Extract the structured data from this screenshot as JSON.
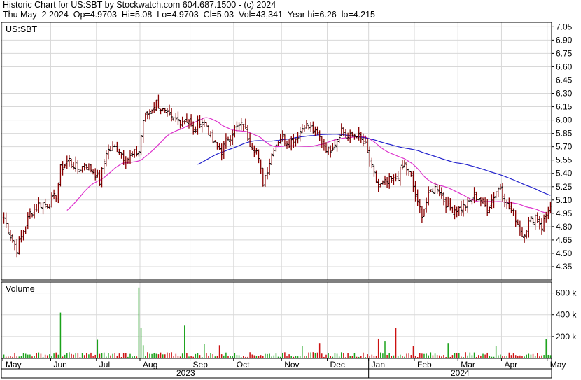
{
  "header": {
    "title": "Historic Chart for US:SBT by Stockwatch.com 604.687.1500 - (c) 2024",
    "quote": "Thu May  2 2024  Op=4.9703  Hi=5.08  Lo=4.9703  Cl=5.03  Vol=43,341  Year hi=6.26  lo=4.215"
  },
  "chart_data": {
    "type": "ohlc-bar",
    "symbol_label": "US:SBT",
    "volume_label": "Volume",
    "price_axis": {
      "ylim": [
        4.2,
        7.1
      ],
      "ticks": [
        "7.05",
        "6.90",
        "6.75",
        "6.60",
        "6.45",
        "6.30",
        "6.15",
        "6.00",
        "5.85",
        "5.70",
        "5.55",
        "5.40",
        "5.25",
        "5.10",
        "4.95",
        "4.80",
        "4.65",
        "4.50",
        "4.35"
      ],
      "grid": true
    },
    "volume_axis": {
      "ylim": [
        0,
        700000
      ],
      "ticks": [
        {
          "label": "600 k",
          "value": 600000
        },
        {
          "label": "400 k",
          "value": 400000
        },
        {
          "label": "200 k",
          "value": 200000
        }
      ]
    },
    "months": [
      "May",
      "Jun",
      "Jul",
      "Aug",
      "Sep",
      "Oct",
      "Nov",
      "Dec",
      "Jan",
      "Feb",
      "Mar",
      "Apr",
      "May"
    ],
    "years": [
      "2023",
      "2024"
    ],
    "year_of_month": [
      0,
      0,
      0,
      0,
      0,
      0,
      0,
      0,
      1,
      1,
      1,
      1,
      1
    ],
    "days_per_month": [
      22,
      21,
      20,
      23,
      20,
      22,
      21,
      19,
      21,
      20,
      20,
      21,
      2
    ],
    "price_anchors": [
      [
        0,
        4.9
      ],
      [
        3,
        4.7
      ],
      [
        6,
        4.55
      ],
      [
        9,
        4.75
      ],
      [
        12,
        4.95
      ],
      [
        16,
        5.05
      ],
      [
        20,
        5.05
      ],
      [
        24,
        5.15
      ],
      [
        26,
        5.45
      ],
      [
        30,
        5.55
      ],
      [
        34,
        5.45
      ],
      [
        38,
        5.5
      ],
      [
        42,
        5.4
      ],
      [
        44,
        5.3
      ],
      [
        47,
        5.65
      ],
      [
        52,
        5.7
      ],
      [
        56,
        5.55
      ],
      [
        62,
        5.65
      ],
      [
        64,
        6.0
      ],
      [
        67,
        6.1
      ],
      [
        70,
        6.2
      ],
      [
        73,
        6.1
      ],
      [
        77,
        6.0
      ],
      [
        81,
        6.0
      ],
      [
        85,
        6.0
      ],
      [
        87,
        5.85
      ],
      [
        90,
        6.0
      ],
      [
        93,
        5.95
      ],
      [
        96,
        5.75
      ],
      [
        100,
        5.65
      ],
      [
        103,
        5.8
      ],
      [
        106,
        5.9
      ],
      [
        110,
        5.95
      ],
      [
        113,
        5.75
      ],
      [
        116,
        5.65
      ],
      [
        119,
        5.3
      ],
      [
        121,
        5.45
      ],
      [
        124,
        5.7
      ],
      [
        127,
        5.8
      ],
      [
        131,
        5.75
      ],
      [
        134,
        5.8
      ],
      [
        138,
        5.95
      ],
      [
        141,
        5.9
      ],
      [
        145,
        5.8
      ],
      [
        149,
        5.65
      ],
      [
        152,
        5.75
      ],
      [
        155,
        5.9
      ],
      [
        158,
        5.8
      ],
      [
        162,
        5.85
      ],
      [
        166,
        5.7
      ],
      [
        169,
        5.45
      ],
      [
        172,
        5.25
      ],
      [
        176,
        5.3
      ],
      [
        180,
        5.35
      ],
      [
        184,
        5.5
      ],
      [
        187,
        5.35
      ],
      [
        190,
        5.05
      ],
      [
        192,
        4.95
      ],
      [
        196,
        5.2
      ],
      [
        199,
        5.25
      ],
      [
        202,
        5.1
      ],
      [
        205,
        5.0
      ],
      [
        209,
        5.0
      ],
      [
        213,
        5.05
      ],
      [
        216,
        5.15
      ],
      [
        219,
        5.1
      ],
      [
        222,
        5.0
      ],
      [
        226,
        5.2
      ],
      [
        228,
        5.25
      ],
      [
        231,
        5.05
      ],
      [
        235,
        4.9
      ],
      [
        238,
        4.7
      ],
      [
        241,
        4.85
      ],
      [
        244,
        4.92
      ],
      [
        247,
        4.8
      ],
      [
        250,
        5.0
      ],
      [
        251,
        5.03
      ]
    ],
    "moving_averages": [
      {
        "name": "MA short",
        "color": "#dd33cc",
        "period": 30
      },
      {
        "name": "MA long",
        "color": "#2222cc",
        "period": 90
      }
    ],
    "volume_spikes": [
      [
        26,
        420000
      ],
      [
        43,
        170000
      ],
      [
        62,
        650000
      ],
      [
        63,
        280000
      ],
      [
        64,
        120000
      ],
      [
        83,
        300000
      ],
      [
        92,
        130000
      ],
      [
        99,
        120000
      ],
      [
        137,
        110000
      ],
      [
        145,
        140000
      ],
      [
        172,
        180000
      ],
      [
        175,
        160000
      ],
      [
        180,
        280000
      ],
      [
        188,
        110000
      ],
      [
        204,
        140000
      ],
      [
        226,
        110000
      ],
      [
        249,
        175000
      ]
    ],
    "bar_colors": {
      "up": "#1aa21a",
      "down": "#cc1111",
      "price_bar": "#880000",
      "price_tick": "#000000"
    }
  }
}
